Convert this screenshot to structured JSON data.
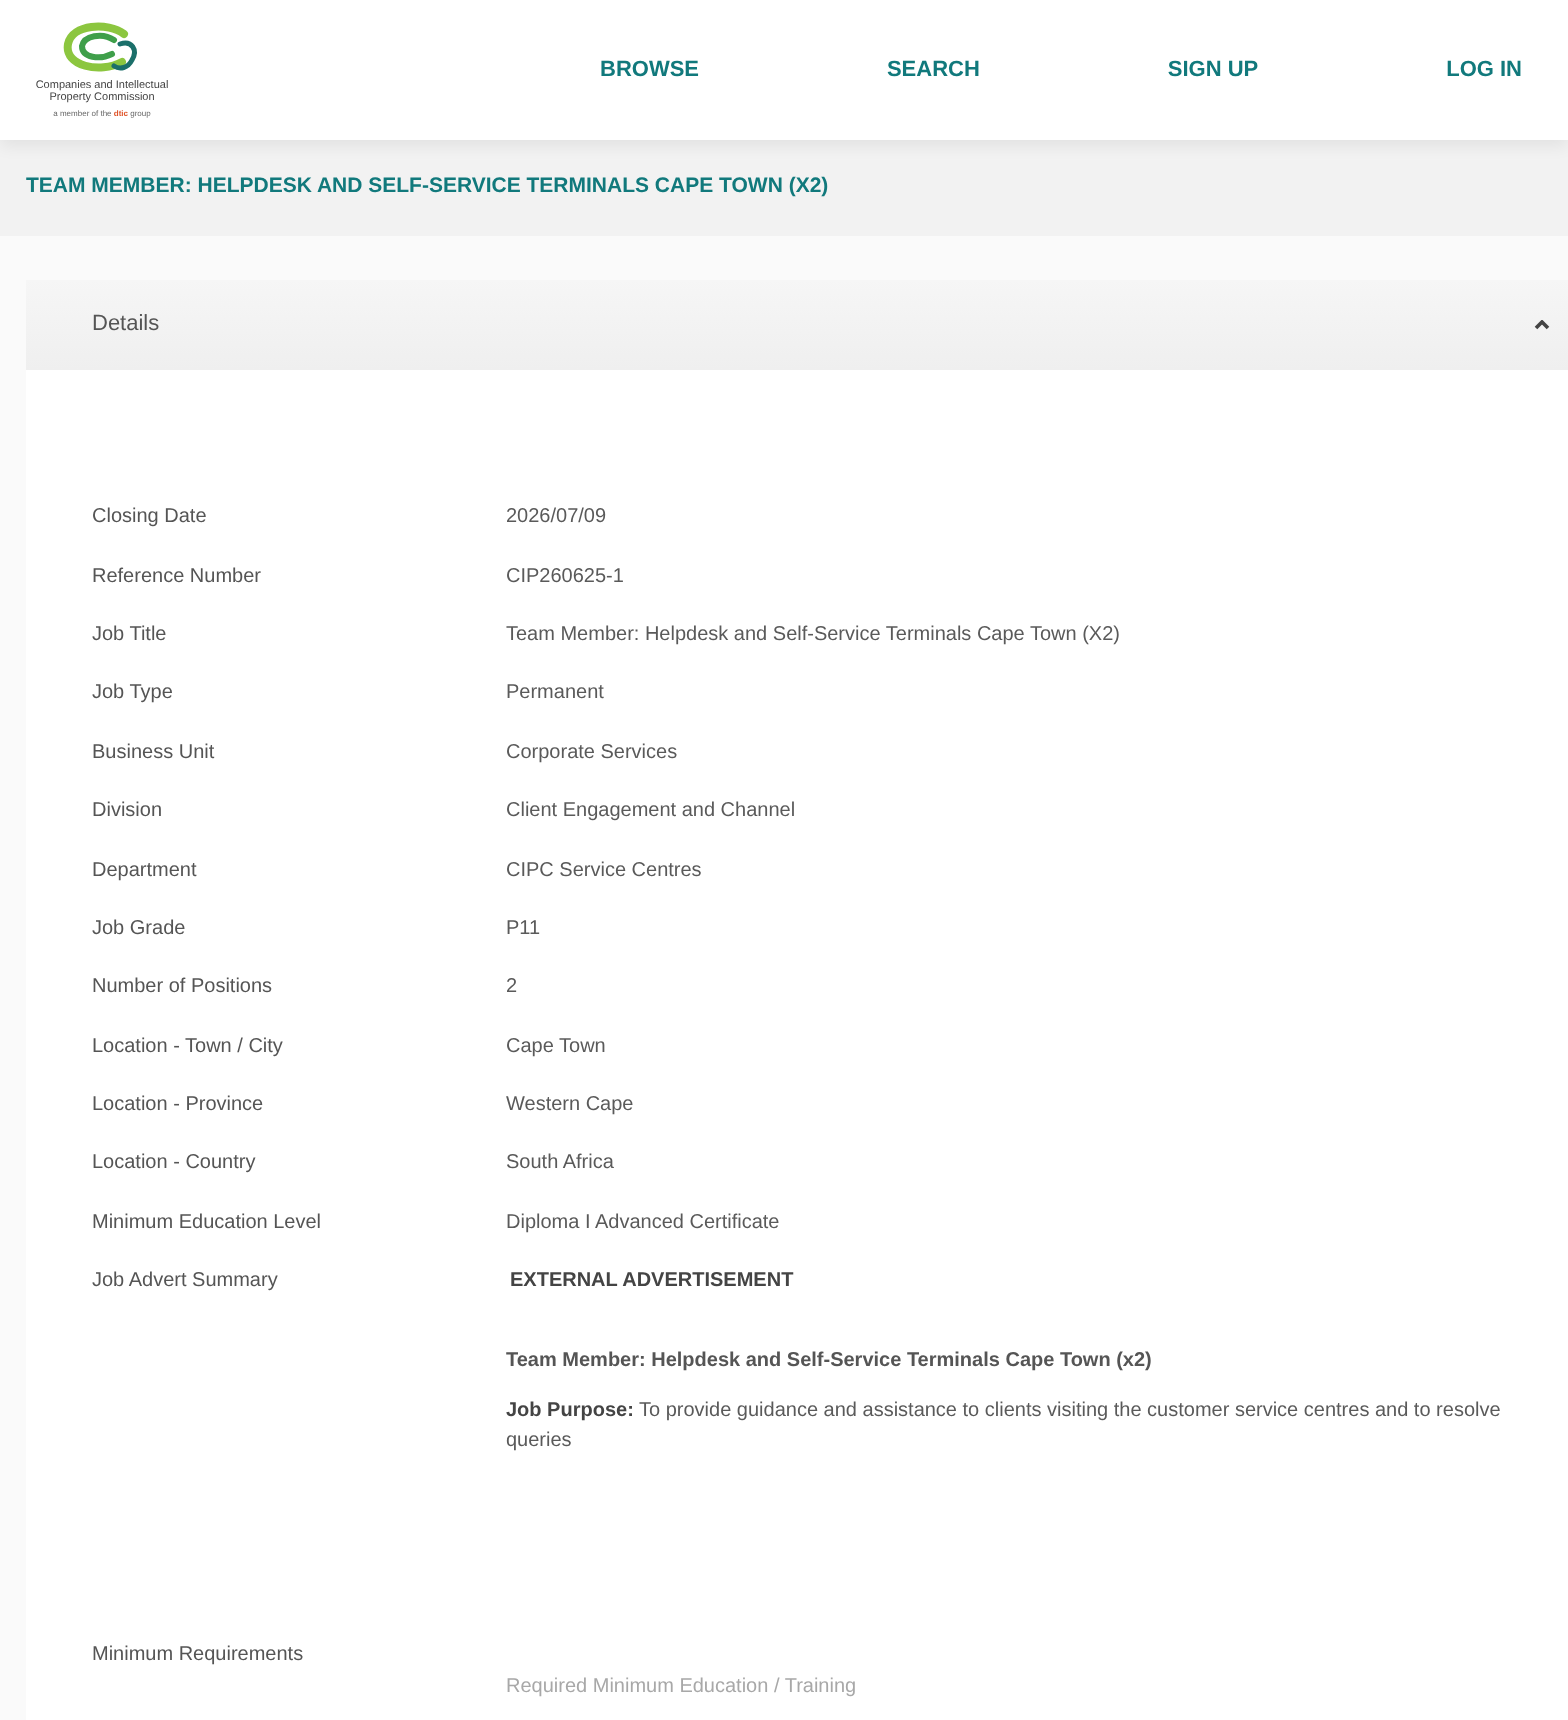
{
  "header": {
    "logo": {
      "name_lines": [
        "Companies and Intellectual",
        "Property Commission"
      ],
      "tagline": "a member of the **dtic** group"
    },
    "nav": [
      {
        "label": "BROWSE"
      },
      {
        "label": "SEARCH"
      },
      {
        "label": "SIGN UP"
      },
      {
        "label": "LOG IN"
      }
    ]
  },
  "page_title": "TEAM MEMBER: HELPDESK AND SELF-SERVICE TERMINALS CAPE TOWN (X2)",
  "details_panel": {
    "title": "Details",
    "expanded": true,
    "fields": [
      {
        "kind": "plain",
        "label": "Closing Date",
        "value": "2026/07/09"
      },
      {
        "kind": "plain",
        "label": "Reference Number",
        "value": "CIP260625-1"
      },
      {
        "kind": "plain",
        "label": "Job Title",
        "value": "Team Member: Helpdesk and Self-Service Terminals Cape Town (X2)"
      },
      {
        "kind": "plain",
        "label": "Job Type",
        "value": "Permanent"
      },
      {
        "kind": "plain",
        "label": "Business Unit",
        "value": "Corporate Services"
      },
      {
        "kind": "plain",
        "label": "Division",
        "value": "Client Engagement and Channel"
      },
      {
        "kind": "plain",
        "label": "Department",
        "value": "CIPC Service Centres"
      },
      {
        "kind": "plain",
        "label": "Job Grade",
        "value": "P11"
      },
      {
        "kind": "plain",
        "label": "Number of Positions",
        "value": "2"
      },
      {
        "kind": "plain",
        "label": "Location - Town / City",
        "value": "Cape Town"
      },
      {
        "kind": "plain",
        "label": "Location - Province",
        "value": "Western Cape"
      },
      {
        "kind": "plain",
        "label": "Location - Country",
        "value": "South Africa"
      },
      {
        "kind": "plain",
        "label": "Minimum Education Level",
        "value": "Diploma I Advanced Certificate"
      },
      {
        "kind": "summary",
        "label": "Job Advert Summary",
        "value": "EXTERNAL ADVERTISEMENT",
        "paragraphs": [
          {
            "kind": "heading",
            "text": "Team Member: Helpdesk and Self-Service Terminals Cape Town (x2)"
          },
          {
            "kind": "text",
            "text": "**Job Purpose:** To provide guidance and assistance to clients visiting the customer service centres and to resolve queries"
          }
        ]
      },
      {
        "kind": "section",
        "label": "Minimum Requirements",
        "paragraphs": [
          {
            "kind": "subheading",
            "text": "Required Minimum Education / Training"
          }
        ]
      }
    ]
  }
}
